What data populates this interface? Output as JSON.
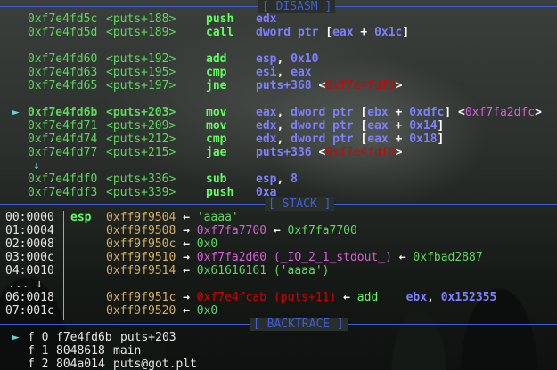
{
  "disasm": {
    "label": "[ DISASM ]",
    "lines": [
      {
        "marker": "",
        "addr": "0xf7e4fd5c",
        "sym": "<puts+188>",
        "mnem": "push",
        "ops": [
          [
            "edx",
            "b"
          ]
        ]
      },
      {
        "marker": "",
        "addr": "0xf7e4fd5d",
        "sym": "<puts+189>",
        "mnem": "call",
        "ops": [
          [
            "dword ptr ",
            "b"
          ],
          [
            "[",
            "w"
          ],
          [
            "eax",
            "b"
          ],
          [
            " + ",
            "w"
          ],
          [
            "0x1c",
            "b"
          ],
          [
            "]",
            "w"
          ]
        ]
      },
      {
        "marker": "",
        "addr": "0xf7e4fd60",
        "sym": "<puts+192>",
        "mnem": "add",
        "ops": [
          [
            "esp",
            "b"
          ],
          [
            ", ",
            "w"
          ],
          [
            "0x10",
            "b"
          ]
        ]
      },
      {
        "marker": "",
        "addr": "0xf7e4fd63",
        "sym": "<puts+195>",
        "mnem": "cmp",
        "ops": [
          [
            "esi",
            "b"
          ],
          [
            ", ",
            "w"
          ],
          [
            "eax",
            "b"
          ]
        ]
      },
      {
        "marker": "",
        "addr": "0xf7e4fd65",
        "sym": "<puts+197>",
        "mnem": "jne",
        "ops": [
          [
            "puts+368 ",
            "b"
          ],
          [
            "<",
            "w"
          ],
          [
            "0xf7e4fdf0",
            "r"
          ],
          [
            ">",
            "w"
          ]
        ]
      },
      {
        "marker": "►",
        "addr": "0xf7e4fd6b",
        "sym": "<puts+203>",
        "mnem": "mov",
        "ops": [
          [
            "eax",
            "b"
          ],
          [
            ", ",
            "w"
          ],
          [
            "dword ptr ",
            "b"
          ],
          [
            "[",
            "w"
          ],
          [
            "ebx",
            "b"
          ],
          [
            " + ",
            "w"
          ],
          [
            "0xdfc",
            "b"
          ],
          [
            "] ",
            "w"
          ],
          [
            "<",
            "w"
          ],
          [
            "0xf7fa2dfc",
            "m"
          ],
          [
            ">",
            "w"
          ]
        ]
      },
      {
        "marker": "",
        "addr": "0xf7e4fd71",
        "sym": "<puts+209>",
        "mnem": "mov",
        "ops": [
          [
            "edx",
            "b"
          ],
          [
            ", ",
            "w"
          ],
          [
            "dword ptr ",
            "b"
          ],
          [
            "[",
            "w"
          ],
          [
            "eax",
            "b"
          ],
          [
            " + ",
            "w"
          ],
          [
            "0x14",
            "b"
          ],
          [
            "]",
            "w"
          ]
        ]
      },
      {
        "marker": "",
        "addr": "0xf7e4fd74",
        "sym": "<puts+212>",
        "mnem": "cmp",
        "ops": [
          [
            "edx",
            "b"
          ],
          [
            ", ",
            "w"
          ],
          [
            "dword ptr ",
            "b"
          ],
          [
            "[",
            "w"
          ],
          [
            "eax",
            "b"
          ],
          [
            " + ",
            "w"
          ],
          [
            "0x18",
            "b"
          ],
          [
            "]",
            "w"
          ]
        ]
      },
      {
        "marker": "",
        "addr": "0xf7e4fd77",
        "sym": "<puts+215>",
        "mnem": "jae",
        "ops": [
          [
            "puts+336 ",
            "b"
          ],
          [
            "<",
            "w"
          ],
          [
            "0xf7e4fdf0",
            "r"
          ],
          [
            ">",
            "w"
          ]
        ]
      },
      {
        "marker": "",
        "addr": "0xf7e4fdf0",
        "sym": "<puts+336>",
        "mnem": "sub",
        "ops": [
          [
            "esp",
            "b"
          ],
          [
            ", ",
            "w"
          ],
          [
            "8",
            "b"
          ]
        ]
      },
      {
        "marker": "",
        "addr": "0xf7e4fdf3",
        "sym": "<puts+339>",
        "mnem": "push",
        "ops": [
          [
            "0xa",
            "b"
          ]
        ]
      }
    ],
    "down_arrow": "↓"
  },
  "stack": {
    "label": "[ STACK ]",
    "ellipsis": "... ↓",
    "rows": [
      {
        "idx": "00:0000",
        "reg": "esp",
        "parts": [
          [
            "0xff9f9504",
            "y"
          ],
          [
            " ← ",
            "w"
          ],
          [
            "'aaaa'",
            "g"
          ]
        ]
      },
      {
        "idx": "01:0004",
        "reg": "",
        "parts": [
          [
            "0xff9f9508",
            "y"
          ],
          [
            " → ",
            "w"
          ],
          [
            "0xf7fa7700",
            "m"
          ],
          [
            " ← ",
            "w"
          ],
          [
            "0xf7fa7700",
            "g"
          ]
        ]
      },
      {
        "idx": "02:0008",
        "reg": "",
        "parts": [
          [
            "0xff9f950c",
            "y"
          ],
          [
            " ← ",
            "w"
          ],
          [
            "0x0",
            "g"
          ]
        ]
      },
      {
        "idx": "03:000c",
        "reg": "",
        "parts": [
          [
            "0xff9f9510",
            "y"
          ],
          [
            " → ",
            "w"
          ],
          [
            "0xf7fa2d60 (_IO_2_1_stdout_)",
            "m"
          ],
          [
            " ← ",
            "w"
          ],
          [
            "0xfbad2887",
            "g"
          ]
        ]
      },
      {
        "idx": "04:0010",
        "reg": "",
        "parts": [
          [
            "0xff9f9514",
            "y"
          ],
          [
            " ← ",
            "w"
          ],
          [
            "0x61616161 ('aaaa')",
            "g"
          ]
        ]
      },
      {
        "idx": "06:0018",
        "reg": "",
        "parts": [
          [
            "0xff9f951c",
            "y"
          ],
          [
            " → ",
            "w"
          ],
          [
            "0xf7e4fcab (puts+11)",
            "r"
          ],
          [
            " ← ",
            "w"
          ],
          [
            "add",
            "g2"
          ],
          [
            "    ",
            "w"
          ],
          [
            "ebx",
            "b"
          ],
          [
            ", ",
            "w"
          ],
          [
            "0x152355",
            "b"
          ]
        ]
      },
      {
        "idx": "07:001c",
        "reg": "",
        "parts": [
          [
            "0xff9f9520",
            "y"
          ],
          [
            " ← ",
            "w"
          ],
          [
            "0x0",
            "g"
          ]
        ]
      }
    ]
  },
  "backtrace": {
    "label": "[ BACKTRACE ]",
    "frames": [
      {
        "marker": "►",
        "frame": "f 0",
        "addr": "f7e4fd6b",
        "sym": "puts+203"
      },
      {
        "marker": "",
        "frame": "f 1",
        "addr": "8048618",
        "sym": "main"
      },
      {
        "marker": "",
        "frame": "f 2",
        "addr": "804a014",
        "sym": "puts@got.plt"
      }
    ]
  },
  "colors": {
    "addr": "#5fd75f",
    "mnemonic": "#5fff5f",
    "register": "#7f7fff",
    "code_ptr": "#d70000",
    "data_ptr": "#d75fd7",
    "stack_addr": "#d7af5f",
    "header": "#3f5fd7"
  }
}
